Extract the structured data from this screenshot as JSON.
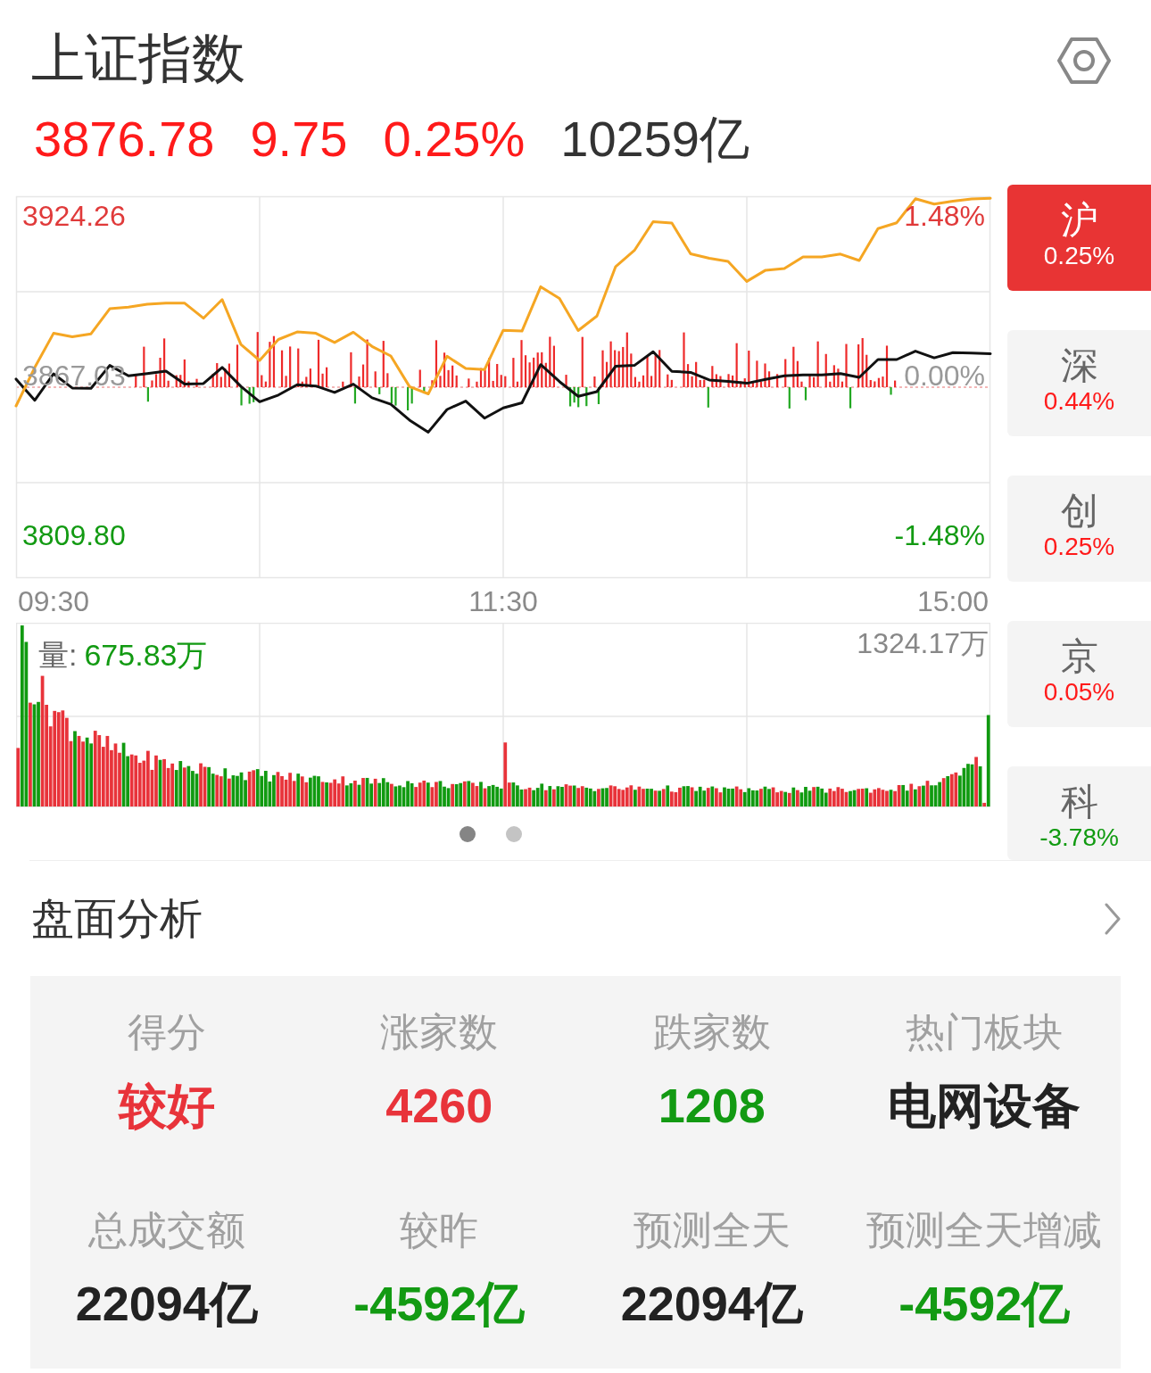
{
  "header": {
    "title": "上证指数"
  },
  "quote": {
    "rising": true,
    "price": "3876.78",
    "change": "9.75",
    "change_pct": "0.25%",
    "turnover": "10259亿"
  },
  "price_chart": {
    "chart_data": {
      "type": "line",
      "grid": true,
      "categories": [
        null,
        null,
        "09:30",
        null,
        null,
        null,
        null,
        null,
        null,
        null,
        null,
        null,
        null,
        null,
        null,
        null,
        null,
        null,
        null,
        null,
        null,
        null,
        null,
        null,
        null,
        null,
        "11:30",
        null,
        null,
        null,
        null,
        null,
        null,
        null,
        null,
        null,
        null,
        null,
        null,
        null,
        null,
        null,
        null,
        null,
        null,
        null,
        null,
        null,
        null,
        null,
        "15:00",
        null,
        null
      ],
      "ylim": [
        3794.5,
        3931.3
      ],
      "yticks": [
        {
          "value": 3924.26,
          "label": "3924.26"
        },
        {
          "value": 3867.03,
          "label": "3867.03"
        },
        {
          "value": 3809.8,
          "label": "3809.80"
        }
      ],
      "series": [
        {
          "color": "#111111",
          "values": [
            3865.8,
            3858.2,
            3867.7,
            3862.6,
            3862.5,
            3870.7,
            3867.0,
            3867.8,
            3868.7,
            3864.0,
            3864.2,
            3870.0,
            3863.2,
            3857.7,
            3860.1,
            3863.8,
            3863.3,
            3861.0,
            3864.0,
            3859.1,
            3856.8,
            3851.1,
            3846.8,
            3854.9,
            3857.9,
            3851.8,
            3855.5,
            3857.3,
            3871.0,
            3864.9,
            3859.6,
            3861.3,
            3870.4,
            3870.7,
            3875.6,
            3868.6,
            3868.2,
            3865.5,
            3865.0,
            3864.3,
            3865.7,
            3867.0,
            3867.3,
            3867.3,
            3867.8,
            3866.4,
            3872.8,
            3872.8,
            3875.8,
            3873.4,
            3875.3,
            3875.1,
            3874.9
          ]
        },
        {
          "color": "#f5a623",
          "values": [
            3856.2,
            3870.0,
            3882.2,
            3881.0,
            3882.0,
            3891.0,
            3891.6,
            3892.6,
            3893.0,
            3893.0,
            3887.6,
            3894.3,
            3878.2,
            3872.5,
            3880.0,
            3882.7,
            3882.2,
            3878.9,
            3882.6,
            3877.5,
            3874.1,
            3863.1,
            3860.5,
            3874.0,
            3869.6,
            3869.2,
            3883.3,
            3883.0,
            3898.9,
            3894.7,
            3883.2,
            3888.4,
            3906.1,
            3911.9,
            3922.2,
            3921.7,
            3910.7,
            3909.1,
            3908.0,
            3900.8,
            3904.8,
            3905.4,
            3909.6,
            3909.6,
            3910.6,
            3908.3,
            3919.7,
            3921.8,
            3930.4,
            3928.5,
            3929.5,
            3930.3,
            3930.6
          ]
        }
      ]
    },
    "right_labels": [
      "1.48%",
      "0.00%",
      "-1.48%"
    ]
  },
  "volume_chart": {
    "label": "量:",
    "value": "675.83万",
    "rising": false,
    "max_label": "1324.17万"
  },
  "pager": [
    {
      "selected": true
    },
    {
      "selected": false
    }
  ],
  "market_tabs": [
    {
      "label": "沪",
      "change": "0.25%",
      "selected": true
    },
    {
      "label": "深",
      "change": "0.44%",
      "rising": true,
      "selected": false
    },
    {
      "label": "创",
      "change": "0.25%",
      "rising": true,
      "selected": false
    },
    {
      "label": "京",
      "change": "0.05%",
      "rising": true,
      "selected": false
    },
    {
      "label": "科",
      "change": "-3.78%",
      "rising": false,
      "selected": false
    }
  ],
  "analysis": {
    "title": "盘面分析",
    "stats": [
      {
        "label": "得分",
        "value": "较好",
        "color": "#e8333a"
      },
      {
        "label": "涨家数",
        "value": "4260",
        "color": "#e8333a"
      },
      {
        "label": "跌家数",
        "value": "1208",
        "color": "#129a12"
      },
      {
        "label": "热门板块",
        "value": "电网设备",
        "color": "#222222"
      },
      {
        "label": "总成交额",
        "value": "22094亿",
        "color": "#222222"
      },
      {
        "label": "较昨",
        "value": "-4592亿",
        "color": "#129a12"
      },
      {
        "label": "预测全天",
        "value": "22094亿",
        "color": "#222222"
      },
      {
        "label": "预测全天增减",
        "value": "-4592亿",
        "color": "#129a12"
      }
    ]
  }
}
